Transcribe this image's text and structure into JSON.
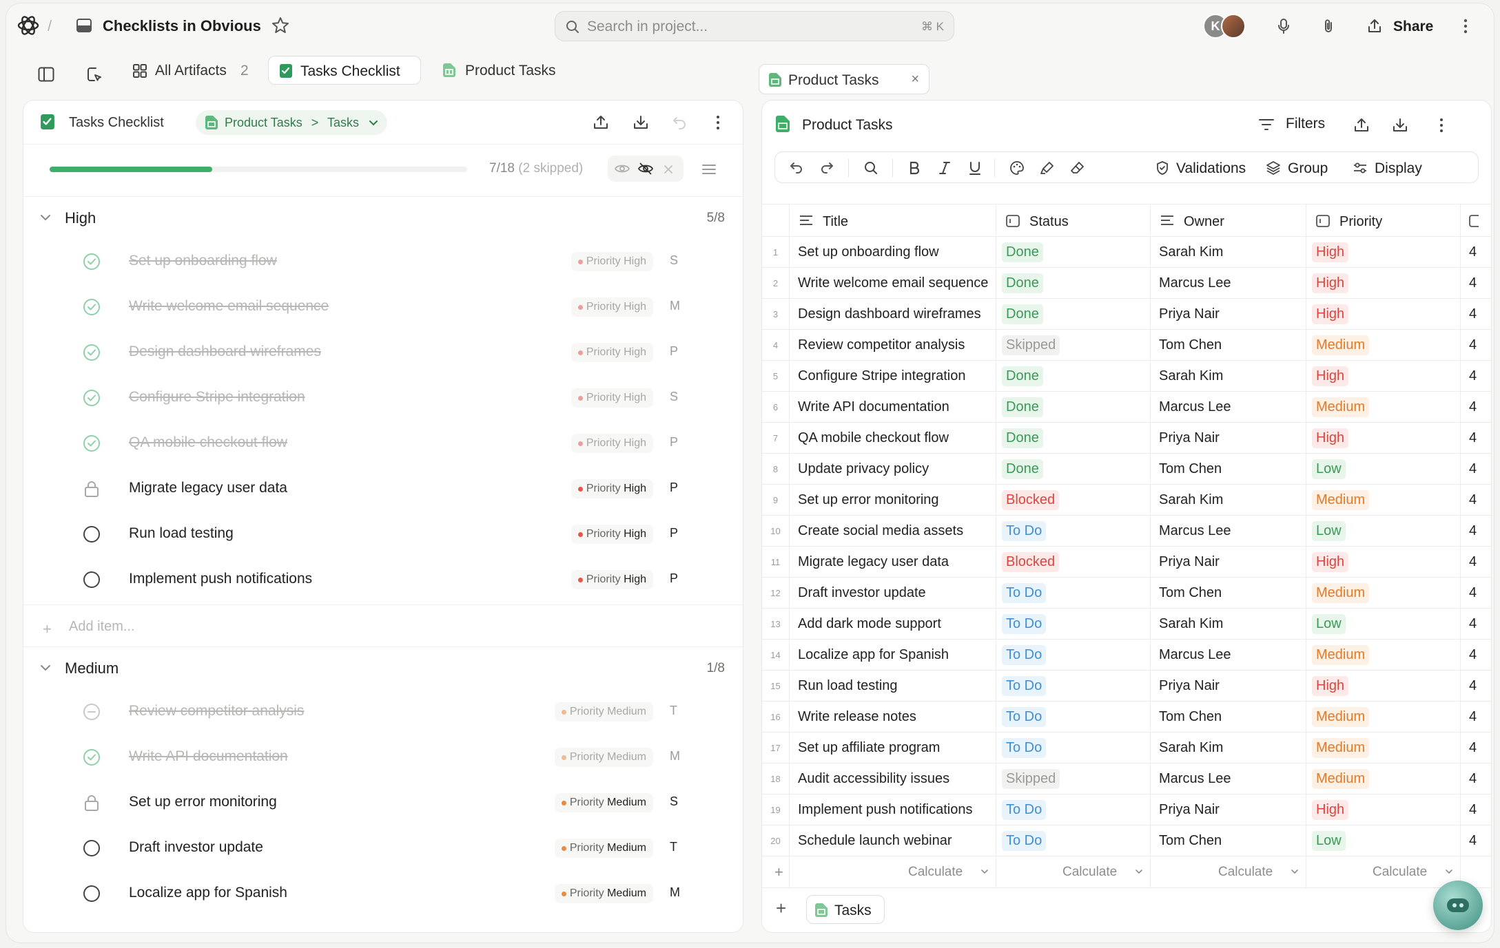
{
  "topbar": {
    "breadcrumb_sep": "/",
    "project_title": "Checklists in Obvious",
    "search_placeholder": "Search in project...",
    "search_shortcut": "⌘ K",
    "avatar_initial": "K",
    "share_label": "Share"
  },
  "left_tabs": {
    "all_artifacts_label": "All Artifacts",
    "all_artifacts_count": "2",
    "tasks_checklist_label": "Tasks Checklist",
    "product_tasks_label": "Product Tasks"
  },
  "checklist": {
    "title": "Tasks Checklist",
    "crumb_parent": "Product Tasks",
    "crumb_sep": ">",
    "crumb_child": "Tasks",
    "progress": {
      "done": 7,
      "total": 18,
      "skipped": 2,
      "fraction": 0.3889,
      "text_main": "7/18",
      "text_skipped": "(2  skipped)"
    },
    "add_item_label": "Add item...",
    "priority_key": "Priority",
    "groups": [
      {
        "name": "High",
        "count": "5/8",
        "tasks": [
          {
            "title": "Set up onboarding flow",
            "state": "done",
            "priority": "High",
            "owner": "S"
          },
          {
            "title": "Write welcome email sequence",
            "state": "done",
            "priority": "High",
            "owner": "M"
          },
          {
            "title": "Design dashboard wireframes",
            "state": "done",
            "priority": "High",
            "owner": "P"
          },
          {
            "title": "Configure Stripe integration",
            "state": "done",
            "priority": "High",
            "owner": "S"
          },
          {
            "title": "QA mobile checkout flow",
            "state": "done",
            "priority": "High",
            "owner": "P"
          },
          {
            "title": "Migrate legacy user data",
            "state": "blocked",
            "priority": "High",
            "owner": "P"
          },
          {
            "title": "Run load testing",
            "state": "todo",
            "priority": "High",
            "owner": "P"
          },
          {
            "title": "Implement push notifications",
            "state": "todo",
            "priority": "High",
            "owner": "P"
          }
        ]
      },
      {
        "name": "Medium",
        "count": "1/8",
        "tasks": [
          {
            "title": "Review competitor analysis",
            "state": "skipped",
            "priority": "Medium",
            "owner": "T"
          },
          {
            "title": "Write API documentation",
            "state": "done",
            "priority": "Medium",
            "owner": "M"
          },
          {
            "title": "Set up error monitoring",
            "state": "blocked",
            "priority": "Medium",
            "owner": "S"
          },
          {
            "title": "Draft investor update",
            "state": "todo",
            "priority": "Medium",
            "owner": "T"
          },
          {
            "title": "Localize app for Spanish",
            "state": "todo",
            "priority": "Medium",
            "owner": "M"
          }
        ]
      }
    ]
  },
  "sheet": {
    "tab_label": "Product Tasks",
    "tab_close": "×",
    "title": "Product Tasks",
    "filters_label": "Filters",
    "validations_label": "Validations",
    "group_label": "Group",
    "display_label": "Display",
    "columns": [
      "Title",
      "Status",
      "Owner",
      "Priority"
    ],
    "calculate_label": "Calculate",
    "sheet_tab_label": "Tasks",
    "extra_col_value": "4",
    "rows": [
      {
        "n": "1",
        "title": "Set up onboarding flow",
        "status": "Done",
        "owner": "Sarah Kim",
        "priority": "High"
      },
      {
        "n": "2",
        "title": "Write welcome email sequence",
        "status": "Done",
        "owner": "Marcus Lee",
        "priority": "High"
      },
      {
        "n": "3",
        "title": "Design dashboard wireframes",
        "status": "Done",
        "owner": "Priya Nair",
        "priority": "High"
      },
      {
        "n": "4",
        "title": "Review competitor analysis",
        "status": "Skipped",
        "owner": "Tom Chen",
        "priority": "Medium"
      },
      {
        "n": "5",
        "title": "Configure Stripe integration",
        "status": "Done",
        "owner": "Sarah Kim",
        "priority": "High"
      },
      {
        "n": "6",
        "title": "Write API documentation",
        "status": "Done",
        "owner": "Marcus Lee",
        "priority": "Medium"
      },
      {
        "n": "7",
        "title": "QA mobile checkout flow",
        "status": "Done",
        "owner": "Priya Nair",
        "priority": "High"
      },
      {
        "n": "8",
        "title": "Update privacy policy",
        "status": "Done",
        "owner": "Tom Chen",
        "priority": "Low"
      },
      {
        "n": "9",
        "title": "Set up error monitoring",
        "status": "Blocked",
        "owner": "Sarah Kim",
        "priority": "Medium"
      },
      {
        "n": "10",
        "title": "Create social media assets",
        "status": "To Do",
        "owner": "Marcus Lee",
        "priority": "Low"
      },
      {
        "n": "11",
        "title": "Migrate legacy user data",
        "status": "Blocked",
        "owner": "Priya Nair",
        "priority": "High"
      },
      {
        "n": "12",
        "title": "Draft investor update",
        "status": "To Do",
        "owner": "Tom Chen",
        "priority": "Medium"
      },
      {
        "n": "13",
        "title": "Add dark mode support",
        "status": "To Do",
        "owner": "Sarah Kim",
        "priority": "Low"
      },
      {
        "n": "14",
        "title": "Localize app for Spanish",
        "status": "To Do",
        "owner": "Marcus Lee",
        "priority": "Medium"
      },
      {
        "n": "15",
        "title": "Run load testing",
        "status": "To Do",
        "owner": "Priya Nair",
        "priority": "High"
      },
      {
        "n": "16",
        "title": "Write release notes",
        "status": "To Do",
        "owner": "Tom Chen",
        "priority": "Medium"
      },
      {
        "n": "17",
        "title": "Set up affiliate program",
        "status": "To Do",
        "owner": "Sarah Kim",
        "priority": "Medium"
      },
      {
        "n": "18",
        "title": "Audit accessibility issues",
        "status": "Skipped",
        "owner": "Marcus Lee",
        "priority": "Medium"
      },
      {
        "n": "19",
        "title": "Implement push notifications",
        "status": "To Do",
        "owner": "Priya Nair",
        "priority": "High"
      },
      {
        "n": "20",
        "title": "Schedule launch webinar",
        "status": "To Do",
        "owner": "Tom Chen",
        "priority": "Low"
      }
    ]
  },
  "colors": {
    "accent_green": "#3fae68",
    "status": {
      "Done": {
        "bg": "#e8f5ea",
        "fg": "#3a9a58"
      },
      "Skipped": {
        "bg": "#f1f1f0",
        "fg": "#9a9a98"
      },
      "Blocked": {
        "bg": "#fde9e8",
        "fg": "#d8473f"
      },
      "To Do": {
        "bg": "#e9f3fc",
        "fg": "#3f8fd6"
      }
    },
    "priority": {
      "High": {
        "bg": "#fde9e8",
        "fg": "#d8473f",
        "dot": "#e7554c"
      },
      "Medium": {
        "bg": "#fdf0e4",
        "fg": "#e07b2c",
        "dot": "#ea8a3d"
      },
      "Low": {
        "bg": "#e8f5ea",
        "fg": "#3a9a58",
        "dot": "#3fae68"
      }
    }
  }
}
